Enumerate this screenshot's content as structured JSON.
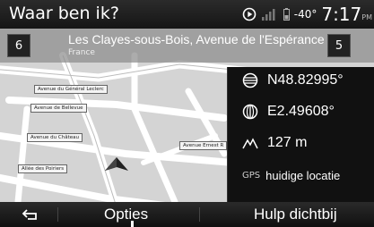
{
  "header": {
    "title": "Waar ben ik?",
    "temperature": "-40°",
    "time": "7:17",
    "ampm": "PM"
  },
  "address_bar": {
    "heading_left": "6",
    "heading_right": "5",
    "address": "Les Clayes-sous-Bois, Avenue de l'Espérance",
    "country": "France"
  },
  "map": {
    "street_labels": [
      "Avenue du Général Leclerc",
      "Avenue de Bellevue",
      "Avenue du Château",
      "Allée des Poiriers",
      "Avenue Ernest R"
    ]
  },
  "location_panel": {
    "latitude": "N48.82995°",
    "longitude": "E2.49608°",
    "altitude": "127 m",
    "gps_tag": "GPS",
    "gps_label": "huidige locatie"
  },
  "footer": {
    "options_label": "Opties",
    "help_label": "Hulp dichtbij"
  },
  "icons": {
    "back": "back-arrow-icon",
    "play": "play-circle-icon",
    "signal": "signal-bars-icon",
    "battery": "battery-icon",
    "latitude": "latitude-globe-icon",
    "longitude": "longitude-globe-icon",
    "altitude": "mountain-icon",
    "position": "position-arrow-icon"
  }
}
